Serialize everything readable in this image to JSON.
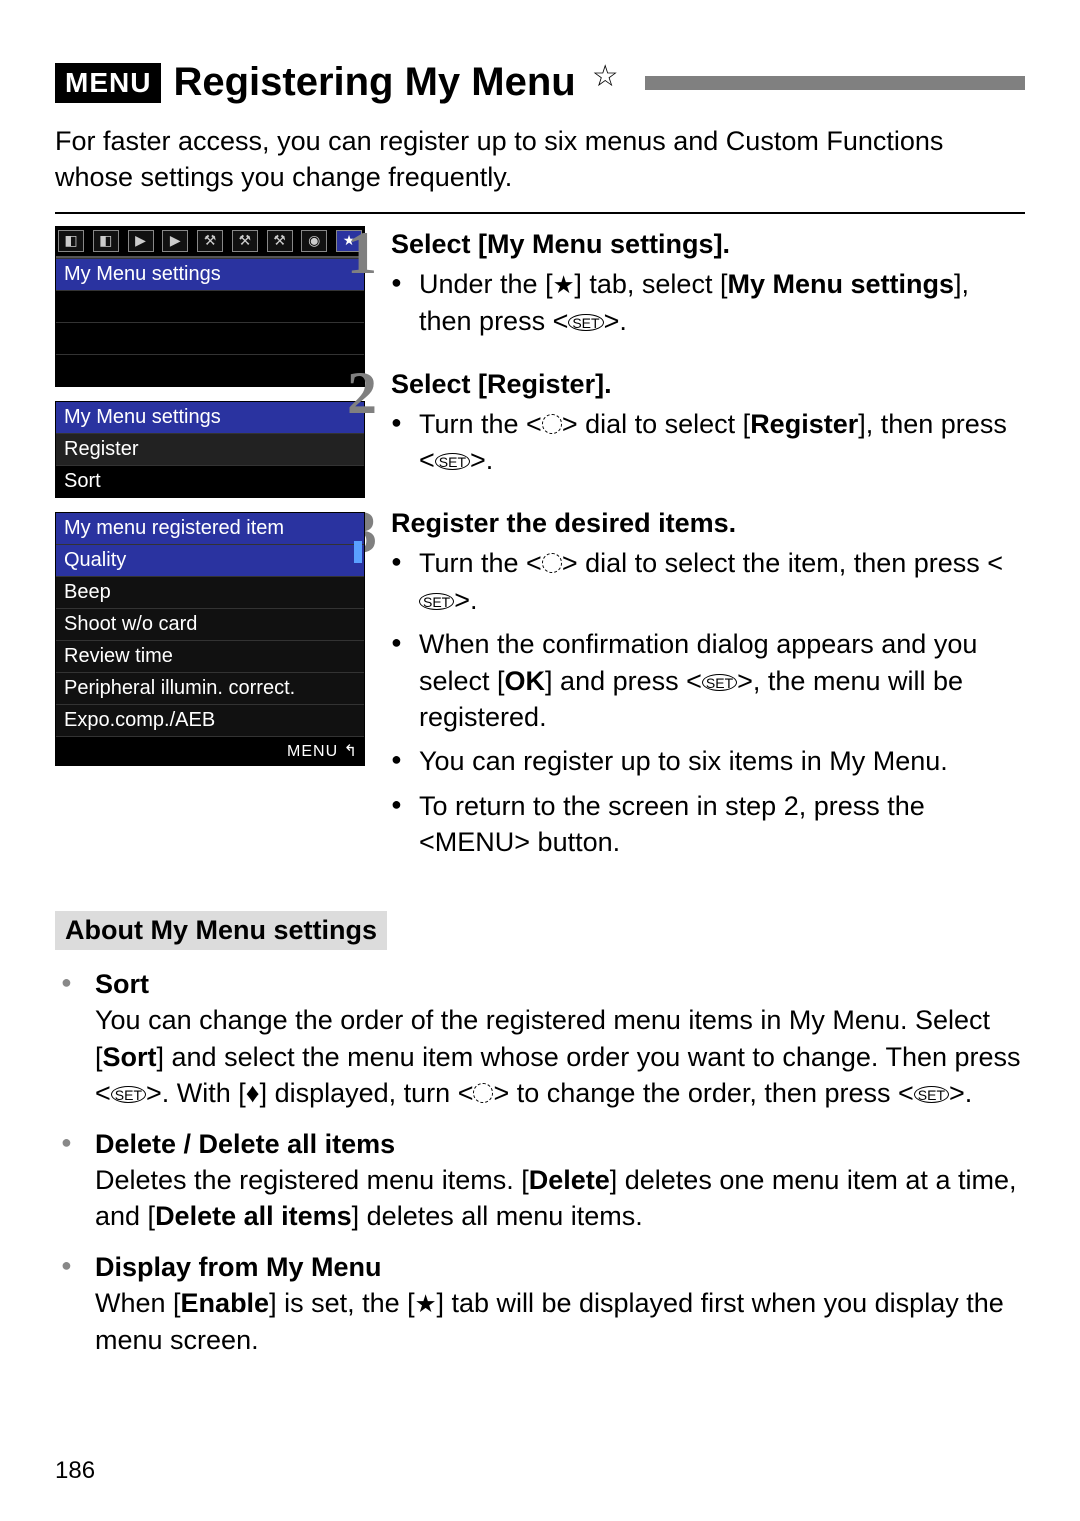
{
  "title": {
    "badge": "MENU",
    "text": "Registering My Menu",
    "star": "☆"
  },
  "intro": "For faster access, you can register up to six menus and Custom Functions whose settings you change frequently.",
  "screens": {
    "s1": {
      "row": "My Menu settings"
    },
    "s2": {
      "header": "My Menu settings",
      "r1": "Register",
      "r2": "Sort"
    },
    "s3": {
      "header": "My menu registered item",
      "r1": "Quality",
      "r2": "Beep",
      "r3": "Shoot w/o card",
      "r4": "Review time",
      "r5": "Peripheral illumin. correct.",
      "r6": "Expo.comp./AEB",
      "back": "MENU ↰"
    }
  },
  "steps": {
    "s1": {
      "num": "1",
      "title": "Select [My Menu settings].",
      "b1a": "Under the [",
      "b1b": "] tab, select [",
      "b1c": "My Menu settings",
      "b1d": "], then press <",
      "b1e": ">."
    },
    "s2": {
      "num": "2",
      "title": "Select [Register].",
      "b1a": "Turn the <",
      "b1b": "> dial to select [",
      "b1c": "Register",
      "b1d": "], then press <",
      "b1e": ">."
    },
    "s3": {
      "num": "3",
      "title": "Register the desired items.",
      "b1a": "Turn the <",
      "b1b": "> dial to select the item, then press <",
      "b1c": ">.",
      "b2a": "When the confirmation dialog appears and you select [",
      "b2b": "OK",
      "b2c": "] and press <",
      "b2d": ">, the menu will be registered.",
      "b3": "You can register up to six items in My Menu.",
      "b4a": "To return to the screen in step 2, press the <",
      "b4b": "MENU",
      "b4c": "> button."
    }
  },
  "aboutHead": "About My Menu settings",
  "about": {
    "sort": {
      "title": "Sort",
      "t1": "You can change the order of the registered menu items in My Menu. Select [",
      "t2": "Sort",
      "t3": "] and select the menu item whose order you want to change. Then press <",
      "t4": ">. With [",
      "t5": "] displayed, turn <",
      "t6": "> to change the order, then press <",
      "t7": ">."
    },
    "delete": {
      "title": "Delete / Delete all items",
      "t1": "Deletes the registered menu items. [",
      "t2": "Delete",
      "t3": "] deletes one menu item at a time, and [",
      "t4": "Delete all items",
      "t5": "] deletes all menu items."
    },
    "display": {
      "title": "Display from My Menu",
      "t1": "When [",
      "t2": "Enable",
      "t3": "] is set, the [",
      "t4": "] tab will be displayed first when you display the menu screen."
    }
  },
  "pageNum": "186",
  "icons": {
    "star": "★",
    "set": "SET",
    "updown": "♦"
  }
}
